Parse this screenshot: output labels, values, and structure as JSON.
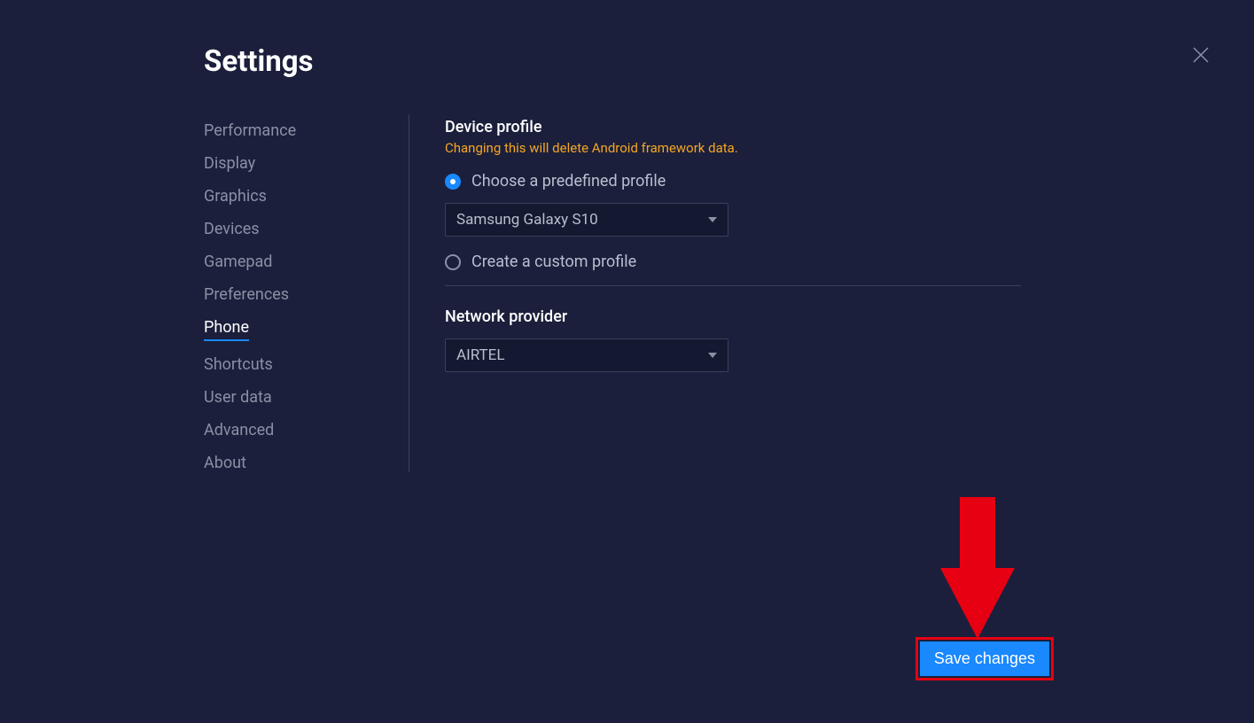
{
  "title": "Settings",
  "sidebar": {
    "items": [
      {
        "label": "Performance"
      },
      {
        "label": "Display"
      },
      {
        "label": "Graphics"
      },
      {
        "label": "Devices"
      },
      {
        "label": "Gamepad"
      },
      {
        "label": "Preferences"
      },
      {
        "label": "Phone"
      },
      {
        "label": "Shortcuts"
      },
      {
        "label": "User data"
      },
      {
        "label": "Advanced"
      },
      {
        "label": "About"
      }
    ],
    "active_index": 6
  },
  "device_profile": {
    "title": "Device profile",
    "warning": "Changing this will delete Android framework data.",
    "predefined_label": "Choose a predefined profile",
    "predefined_value": "Samsung Galaxy S10",
    "custom_label": "Create a custom profile"
  },
  "network": {
    "title": "Network provider",
    "value": "AIRTEL"
  },
  "save_label": "Save changes"
}
